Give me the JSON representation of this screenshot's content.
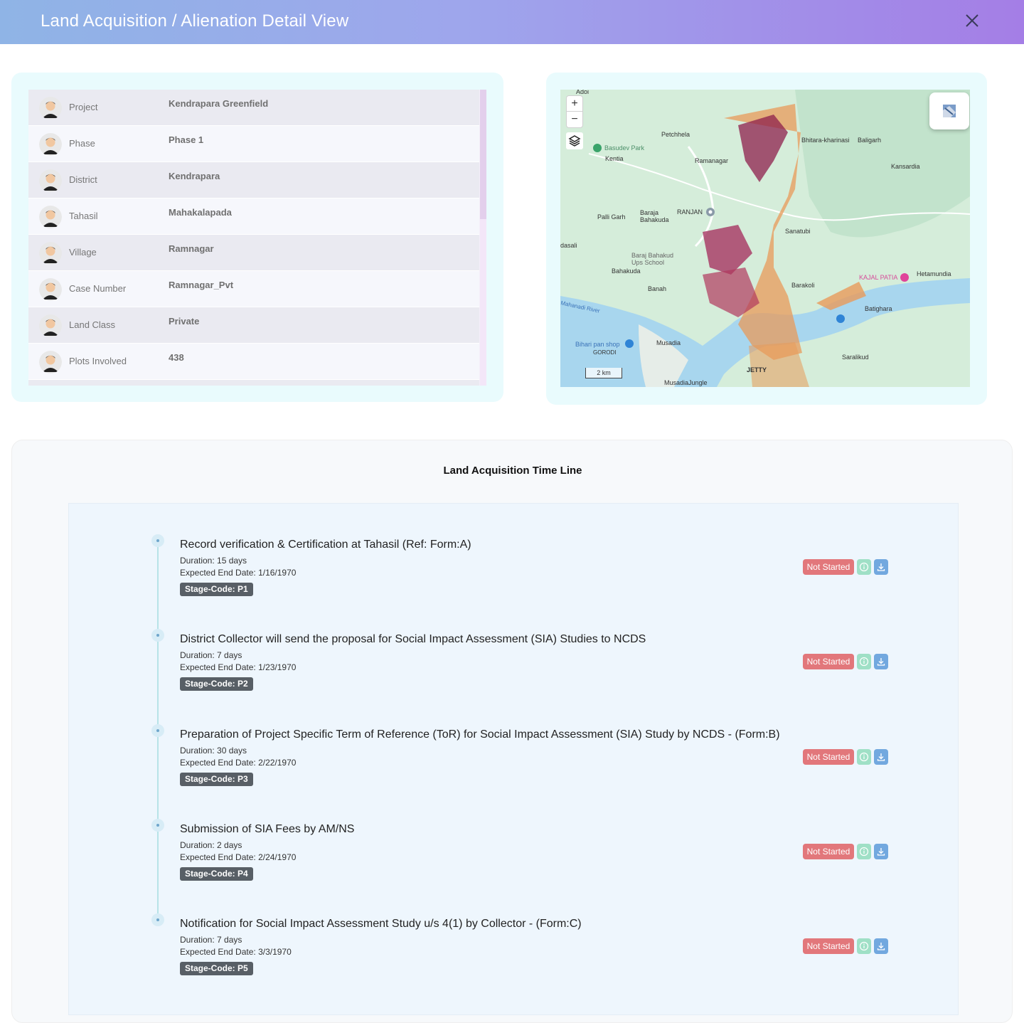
{
  "header": {
    "title": "Land Acquisition / Alienation Detail View"
  },
  "details": [
    {
      "label": "Project",
      "value": "Kendrapara Greenfield"
    },
    {
      "label": "Phase",
      "value": "Phase 1"
    },
    {
      "label": "District",
      "value": "Kendrapara"
    },
    {
      "label": "Tahasil",
      "value": "Mahakalapada"
    },
    {
      "label": "Village",
      "value": "Ramnagar"
    },
    {
      "label": "Case Number",
      "value": "Ramnagar_Pvt"
    },
    {
      "label": "Land Class",
      "value": "Private"
    },
    {
      "label": "Plots Involved",
      "value": "438"
    }
  ],
  "map": {
    "zoom_in": "+",
    "zoom_out": "−",
    "scale": "2 km",
    "places": {
      "adoi": "Adoi",
      "petchhela": "Petchhela",
      "basudev_park": "Basudev Park",
      "kentia": "Kentia",
      "ramanagar": "Ramanagar",
      "bhitara": "Bhitara-kharinasi",
      "baligarh": "Baligarh",
      "kansardia": "Kansardia",
      "palli_garh": "Palli Garh",
      "baraja_bahakuda": "Baraja Bahakuda",
      "ranjan": "RANJAN",
      "sanatubi": "Sanatubi",
      "dasali": "dasali",
      "baraj_school": "Baraj Bahakud Ups School",
      "bahakuda": "Bahakuda",
      "banah": "Banah",
      "barakoli": "Barakoli",
      "kajal_patia": "KAJAL PATIA",
      "hetamundia": "Hetamundia",
      "batighara": "Batighara",
      "mahanadi_river": "Mahanadi River",
      "bihari_pan_shop": "Bihari pan shop",
      "gorodi": "GORODI",
      "musadia": "Musadia",
      "saralikud": "Saralikud",
      "jetty": "JETTY",
      "musadia_jungle": "MusadiaJungle"
    }
  },
  "timeline": {
    "title": "Land Acquisition Time Line",
    "stages": [
      {
        "title": "Record verification & Certification at Tahasil (Ref: Form:A)",
        "duration": "Duration: 15 days",
        "end_date": "Expected End Date: 1/16/1970",
        "code": "Stage-Code: P1",
        "status": "Not Started"
      },
      {
        "title": "District Collector will send the proposal for Social Impact Assessment (SIA) Studies to NCDS",
        "duration": "Duration: 7 days",
        "end_date": "Expected End Date: 1/23/1970",
        "code": "Stage-Code: P2",
        "status": "Not Started"
      },
      {
        "title": "Preparation of Project Specific Term of Reference (ToR) for Social Impact Assessment (SIA) Study by NCDS - (Form:B)",
        "duration": "Duration: 30 days",
        "end_date": "Expected End Date: 2/22/1970",
        "code": "Stage-Code: P3",
        "status": "Not Started"
      },
      {
        "title": "Submission of SIA Fees by AM/NS",
        "duration": "Duration: 2 days",
        "end_date": "Expected End Date: 2/24/1970",
        "code": "Stage-Code: P4",
        "status": "Not Started"
      },
      {
        "title": "Notification for Social Impact Assessment Study u/s 4(1) by Collector - (Form:C)",
        "duration": "Duration: 7 days",
        "end_date": "Expected End Date: 3/3/1970",
        "code": "Stage-Code: P5",
        "status": "Not Started"
      }
    ]
  }
}
